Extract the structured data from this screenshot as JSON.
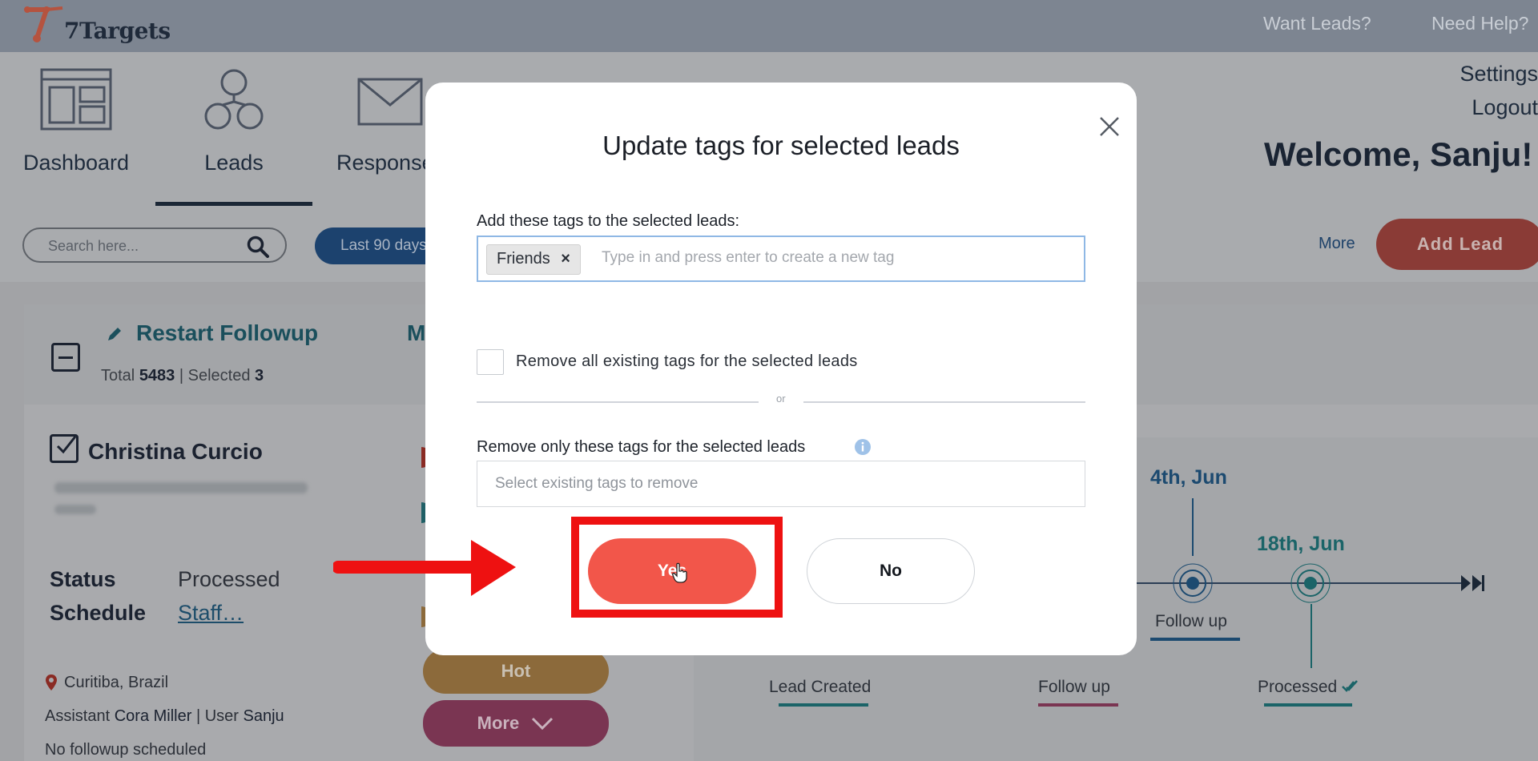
{
  "app": {
    "logo_text": "7Targets",
    "accent": "#f2564a"
  },
  "topbar": {
    "links": [
      "Want Leads?",
      "Need Help?"
    ]
  },
  "nav": {
    "items": [
      {
        "label": "Dashboard",
        "icon": "dashboard-icon"
      },
      {
        "label": "Leads",
        "icon": "leads-icon"
      },
      {
        "label": "Response",
        "icon": "envelope-icon"
      }
    ],
    "settings": "Settings",
    "logout": "Logout",
    "welcome": "Welcome, Sanju!"
  },
  "toolbar": {
    "search_placeholder": "Search here...",
    "period": "Last 90 days",
    "more": "More",
    "add_lead": "Add Lead"
  },
  "bulk": {
    "restart_followup": "Restart Followup",
    "partial_action": "M",
    "total_label": "Total",
    "total": "5483",
    "selected_label": "Selected",
    "selected": "3"
  },
  "lead": {
    "name": "Christina Curcio",
    "status_label": "Status",
    "status": "Processed",
    "schedule_label": "Schedule",
    "schedule": "Staff…",
    "location": "Curitiba, Brazil",
    "assistant_label": "Assistant",
    "assistant": "Cora Miller",
    "user_label": "User",
    "user": "Sanju",
    "followup_note": "No followup scheduled",
    "hot": "Hot",
    "more": "More"
  },
  "timeline": {
    "dates": [
      "4th, Jun",
      "18th, Jun"
    ],
    "labels": [
      "Lead Created",
      "Follow up",
      "Follow up",
      "Processed"
    ]
  },
  "modal": {
    "title": "Update tags for selected leads",
    "add_label": "Add these tags to the selected leads:",
    "chip": "Friends",
    "chip_remove": "×",
    "add_placeholder": "Type in and press enter to create a new tag",
    "remove_all_label": "Remove all existing tags for the selected leads",
    "or": "or",
    "remove_only_label": "Remove only these tags for the selected leads",
    "remove_placeholder": "Select existing tags to remove",
    "yes": "Yes",
    "no": "No"
  }
}
